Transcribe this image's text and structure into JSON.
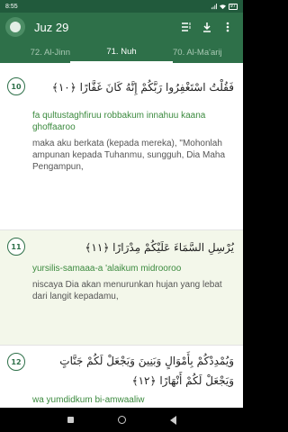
{
  "status": {
    "time": "8:55",
    "battery": "97"
  },
  "header": {
    "title": "Juz 29"
  },
  "tabs": {
    "prev": "72. Al-Jinn",
    "active": "71. Nuh",
    "next": "70. Al-Ma'arij"
  },
  "ayahs": [
    {
      "number": "10",
      "arabic": "فَقُلْتُ اسْتَغْفِرُوا رَبَّكُمْ إِنَّهُ كَانَ غَفَّارًا ﴿١٠﴾",
      "translit": "fa qultustaghfiruu robbakum innahuu kaana ghoffaaroo",
      "translation": "maka aku berkata (kepada mereka), \"Mohonlah ampunan kepada Tuhanmu, sungguh, Dia Maha Pengampun,"
    },
    {
      "number": "11",
      "arabic": "يُرْسِلِ السَّمَاءَ عَلَيْكُمْ مِدْرَارًا ﴿١١﴾",
      "translit": "yursilis-samaaa-a 'alaikum midrooroo",
      "translation": "niscaya Dia akan menurunkan hujan yang lebat dari langit kepadamu,"
    },
    {
      "number": "12",
      "arabic": "وَيُمْدِدْكُمْ بِأَمْوَالٍ وَبَنِينَ وَيَجْعَلْ لَكُمْ جَنَّاتٍ وَيَجْعَلْ لَكُمْ أَنْهَارًا ﴿١٢﴾",
      "translit": "wa yumdidkum bi-amwaaliw",
      "translation": ""
    }
  ],
  "icons": {
    "logo": "quran-logo-icon",
    "list": "list-view-icon",
    "download": "download-icon",
    "menu": "more-vertical-icon"
  },
  "colors": {
    "primary": "#2e7049",
    "statusbar": "#215a3c",
    "translit": "#3b8a3e",
    "alt_row": "#f3f7ea"
  }
}
